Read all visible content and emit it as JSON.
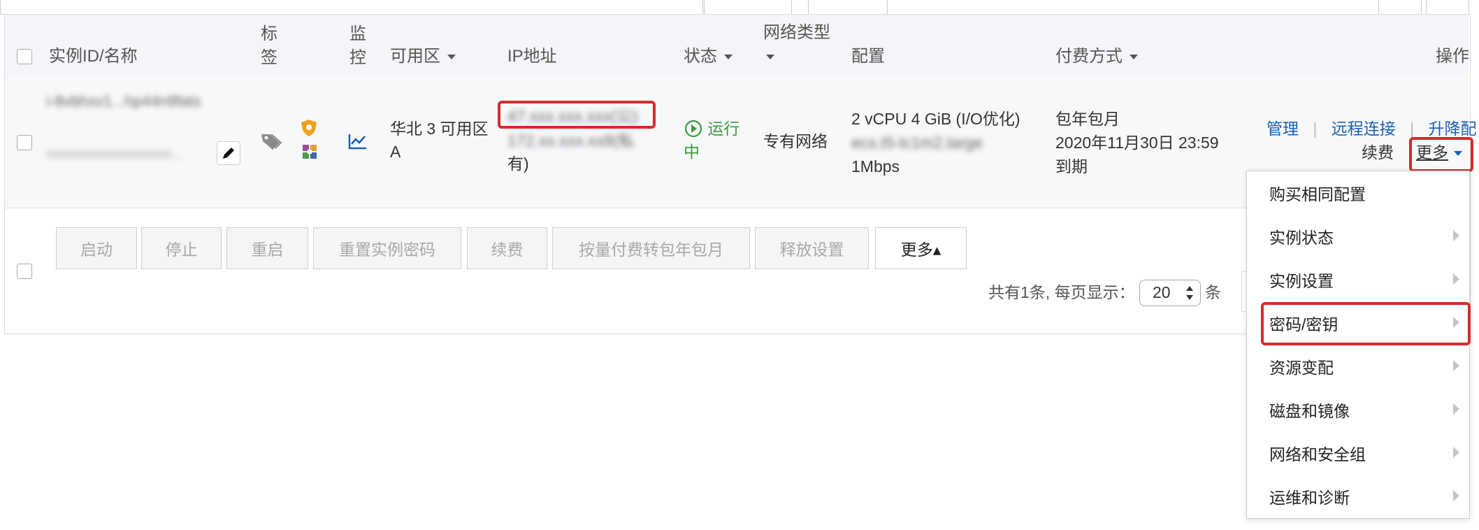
{
  "header": {
    "col_id": "实例ID/名称",
    "col_tag": "标签",
    "col_monitor": "监控",
    "col_zone": "可用区",
    "col_ip": "IP地址",
    "col_status": "状态",
    "col_network": "网络类型",
    "col_config": "配置",
    "col_billing": "付费方式",
    "col_actions": "操作"
  },
  "row": {
    "instance_id": "i-8vbhxv1...hp44n9fats",
    "instance_name": "xxxxxxxxxxxxxxxxxx...",
    "zone": "华北 3 可用区 A",
    "ip_public": "47.xxx.xxx.xxx(公)",
    "ip_private_line1": "172.xx.xxx.xx8(私",
    "ip_private_line2": "有)",
    "status_line1": "运行",
    "status_line2": "中",
    "network": "专有网络",
    "config_line1": "2 vCPU 4 GiB (I/O优化)",
    "config_type": "ecs.t5-lc1m2.large",
    "config_bandwidth": "1Mbps",
    "billing_line1": "包年包月",
    "billing_line2": "2020年11月30日 23:59",
    "billing_line3": "到期",
    "action_manage": "管理",
    "action_remote": "远程连接",
    "action_upgrade": "升降配",
    "action_renew": "续费",
    "action_more": "更多",
    "sep": "|"
  },
  "toolbar": {
    "start": "启动",
    "stop": "停止",
    "restart": "重启",
    "reset_password": "重置实例密码",
    "renew": "续费",
    "convert_billing": "按量付费转包年包月",
    "release_settings": "释放设置",
    "more": "更多▴"
  },
  "pagination": {
    "total_text": "共有1条, 每页显示：",
    "page_size": "20",
    "unit": "条"
  },
  "more_menu": {
    "items": [
      {
        "label": "购买相同配置"
      },
      {
        "label": "实例状态"
      },
      {
        "label": "实例设置"
      },
      {
        "label": "密码/密钥"
      },
      {
        "label": "资源变配"
      },
      {
        "label": "磁盘和镜像"
      },
      {
        "label": "网络和安全组"
      },
      {
        "label": "运维和诊断"
      }
    ]
  },
  "colors": {
    "link": "#1a5fb4",
    "running": "#3a9a3a",
    "highlight": "#d82b2b"
  }
}
